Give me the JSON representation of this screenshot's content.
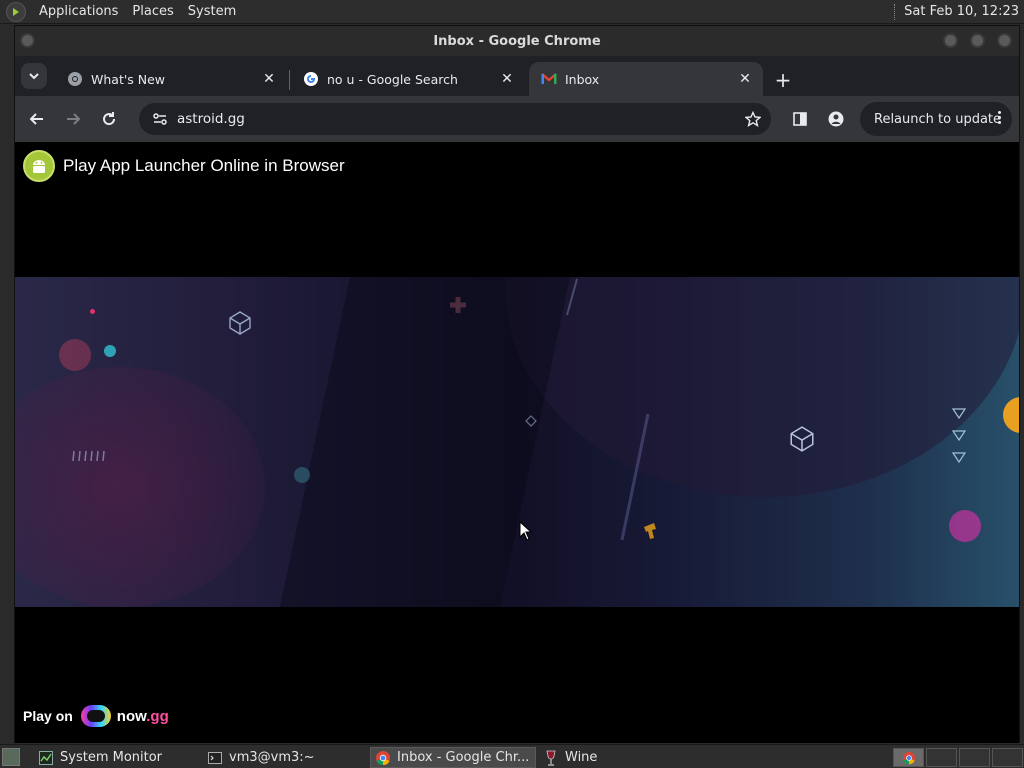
{
  "top_panel": {
    "menus": [
      "Applications",
      "Places",
      "System"
    ],
    "clock": "Sat Feb 10, 12:23"
  },
  "window": {
    "title": "Inbox - Google Chrome"
  },
  "tabs": [
    {
      "title": "What's New",
      "icon": "chrome-icon"
    },
    {
      "title": "no u - Google Search",
      "icon": "google-icon"
    },
    {
      "title": "Inbox",
      "icon": "gmail-icon",
      "active": true
    }
  ],
  "toolbar": {
    "url": "astroid.gg",
    "relaunch_label": "Relaunch to update"
  },
  "page": {
    "title": "Play App Launcher Online in Browser",
    "play_on": "Play on",
    "brand_now": "now",
    "brand_gg": ".gg"
  },
  "taskbar": {
    "items": [
      "System Monitor",
      "vm3@vm3:~",
      "Inbox - Google Chr...",
      "Wine"
    ]
  },
  "colors": {
    "chrome_dark": "#202124",
    "chrome_toolbar": "#35363a",
    "android_green": "#a4c639",
    "nowgg_pink": "#ff4fa2"
  }
}
